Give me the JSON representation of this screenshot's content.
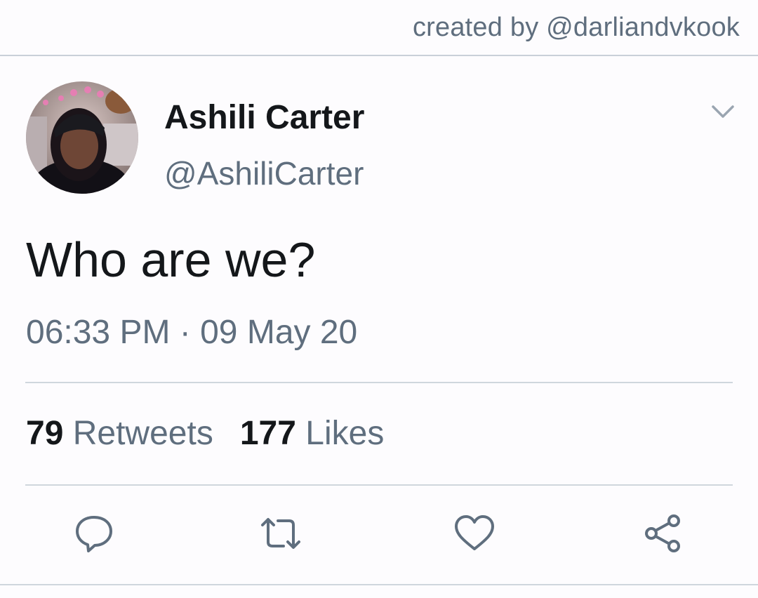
{
  "header": {
    "credit": "created by @darliandvkook"
  },
  "tweet": {
    "author": {
      "display_name": "Ashili Carter",
      "handle": "@AshiliCarter"
    },
    "text": "Who are we?",
    "timestamp": "06:33 PM · 09 May 20",
    "stats": {
      "retweets_count": "79",
      "retweets_label": "Retweets",
      "likes_count": "177",
      "likes_label": "Likes"
    }
  },
  "icons": {
    "more": "chevron-down-icon",
    "reply": "reply-icon",
    "retweet": "retweet-icon",
    "like": "heart-icon",
    "share": "share-icon"
  },
  "colors": {
    "background": "#fdfcfe",
    "primary_text": "#14171a",
    "secondary_text": "#5f6e7e",
    "divider": "#cfd6dd"
  }
}
